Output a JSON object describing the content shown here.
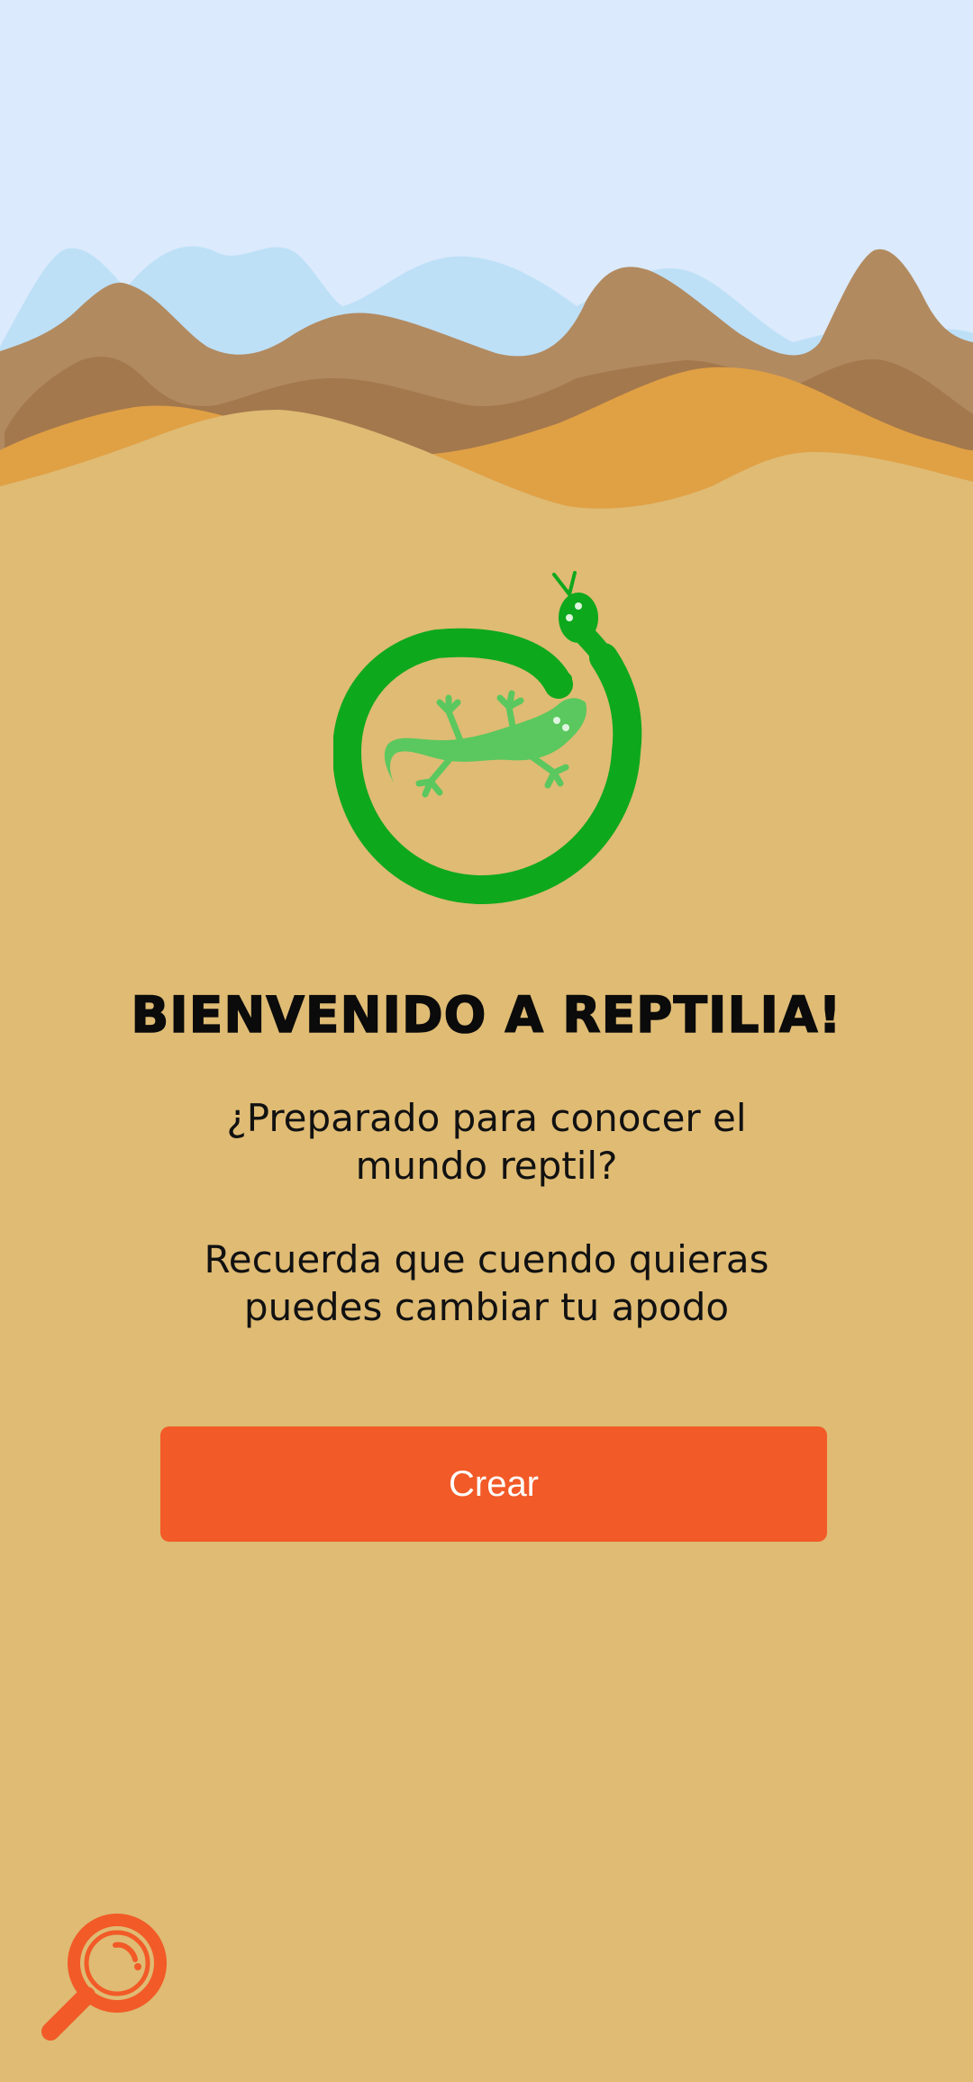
{
  "welcome": {
    "title": "BIENVENIDO A REPTILIA!",
    "line1": "¿Preparado para conocer el mundo reptil?",
    "line2": "Recuerda que cuendo quieras puedes cambiar tu apodo"
  },
  "actions": {
    "create_label": "Crear"
  },
  "colors": {
    "sky": "#dbeafc",
    "sand": "#dfbb74",
    "accent": "#f25a27",
    "logo_green": "#0ea81c",
    "logo_light_green": "#5ac85e"
  },
  "icons": {
    "logo": "snake-lizard-logo",
    "fab": "magnifier-icon"
  }
}
